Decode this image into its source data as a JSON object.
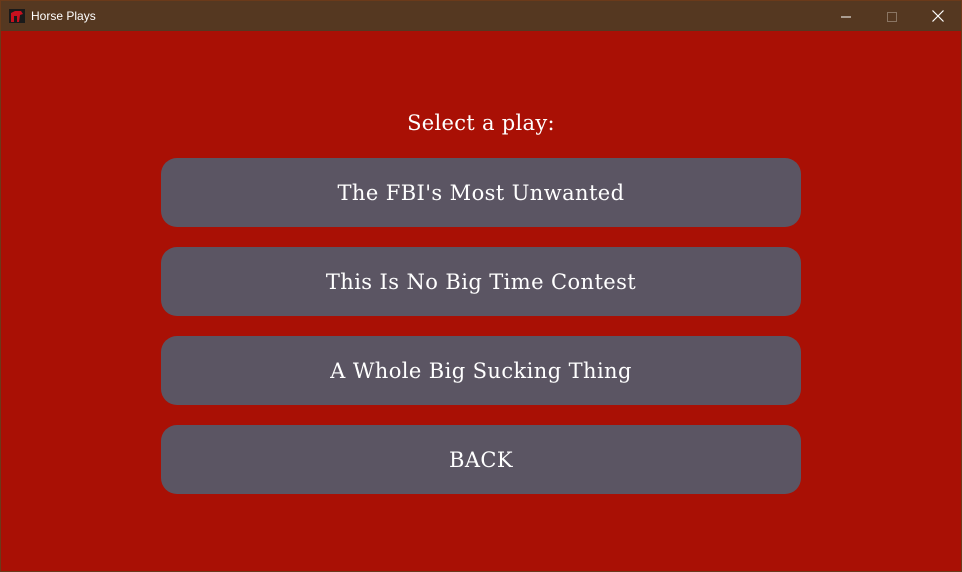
{
  "window": {
    "title": "Horse Plays",
    "icon": "horse-plays-app-icon",
    "controls": {
      "minimize_icon": "minimize-icon",
      "maximize_icon": "maximize-icon",
      "close_icon": "close-icon"
    }
  },
  "colors": {
    "background": "#a91005",
    "titlebar": "#553821",
    "button": "#5b5563",
    "text": "#ffffff"
  },
  "menu": {
    "heading": "Select a play:",
    "buttons": [
      "The FBI's Most Unwanted",
      "This Is No Big Time Contest",
      "A Whole Big Sucking Thing",
      "BACK"
    ]
  }
}
